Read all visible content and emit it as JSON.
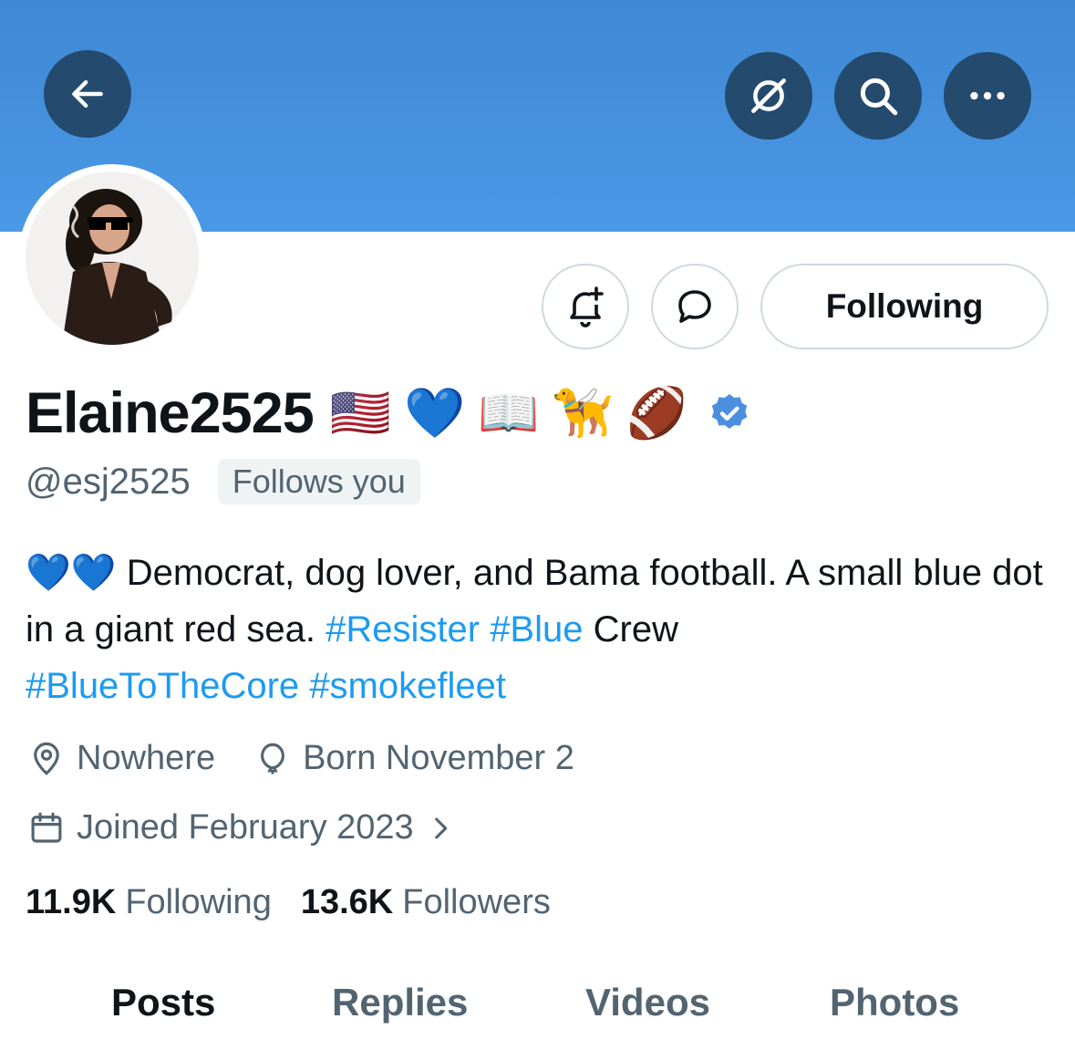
{
  "header": {
    "back_icon": "arrow-left-icon",
    "grok_icon": "grok-icon",
    "search_icon": "search-icon",
    "more_icon": "more-dots-icon",
    "banner_color": "#4a99e6"
  },
  "profile": {
    "display_name": "Elaine2525",
    "name_emojis": [
      "🇺🇸",
      "💙",
      "📖",
      "🦮",
      "🏈"
    ],
    "verified_icon": "verified-badge-icon",
    "handle": "@esj2525",
    "follows_you": "Follows you",
    "bio": {
      "emoji": "💙💙",
      "text": " Democrat, dog lover, and Bama football. A small blue dot in a giant red sea. ",
      "hashtag_1": "#Resister",
      "hashtag_2": "#Blue",
      "text_2": " Crew",
      "hashtag_3": "#BlueToTheCore",
      "hashtag_4": "#smokefleet"
    },
    "location": "Nowhere",
    "birthday": "Born November 2",
    "joined": "Joined February 2023"
  },
  "actions": {
    "notify_icon": "bell-plus-icon",
    "message_icon": "message-bubble-icon",
    "following_label": "Following"
  },
  "stats": {
    "following_count": "11.9K",
    "following_label": "Following",
    "followers_count": "13.6K",
    "followers_label": "Followers"
  },
  "tabs": [
    {
      "label": "Posts",
      "active": true
    },
    {
      "label": "Replies",
      "active": false
    },
    {
      "label": "Videos",
      "active": false
    },
    {
      "label": "Photos",
      "active": false
    }
  ],
  "colors": {
    "link": "#1d9bf0",
    "muted": "#536471",
    "text": "#0f1419"
  }
}
